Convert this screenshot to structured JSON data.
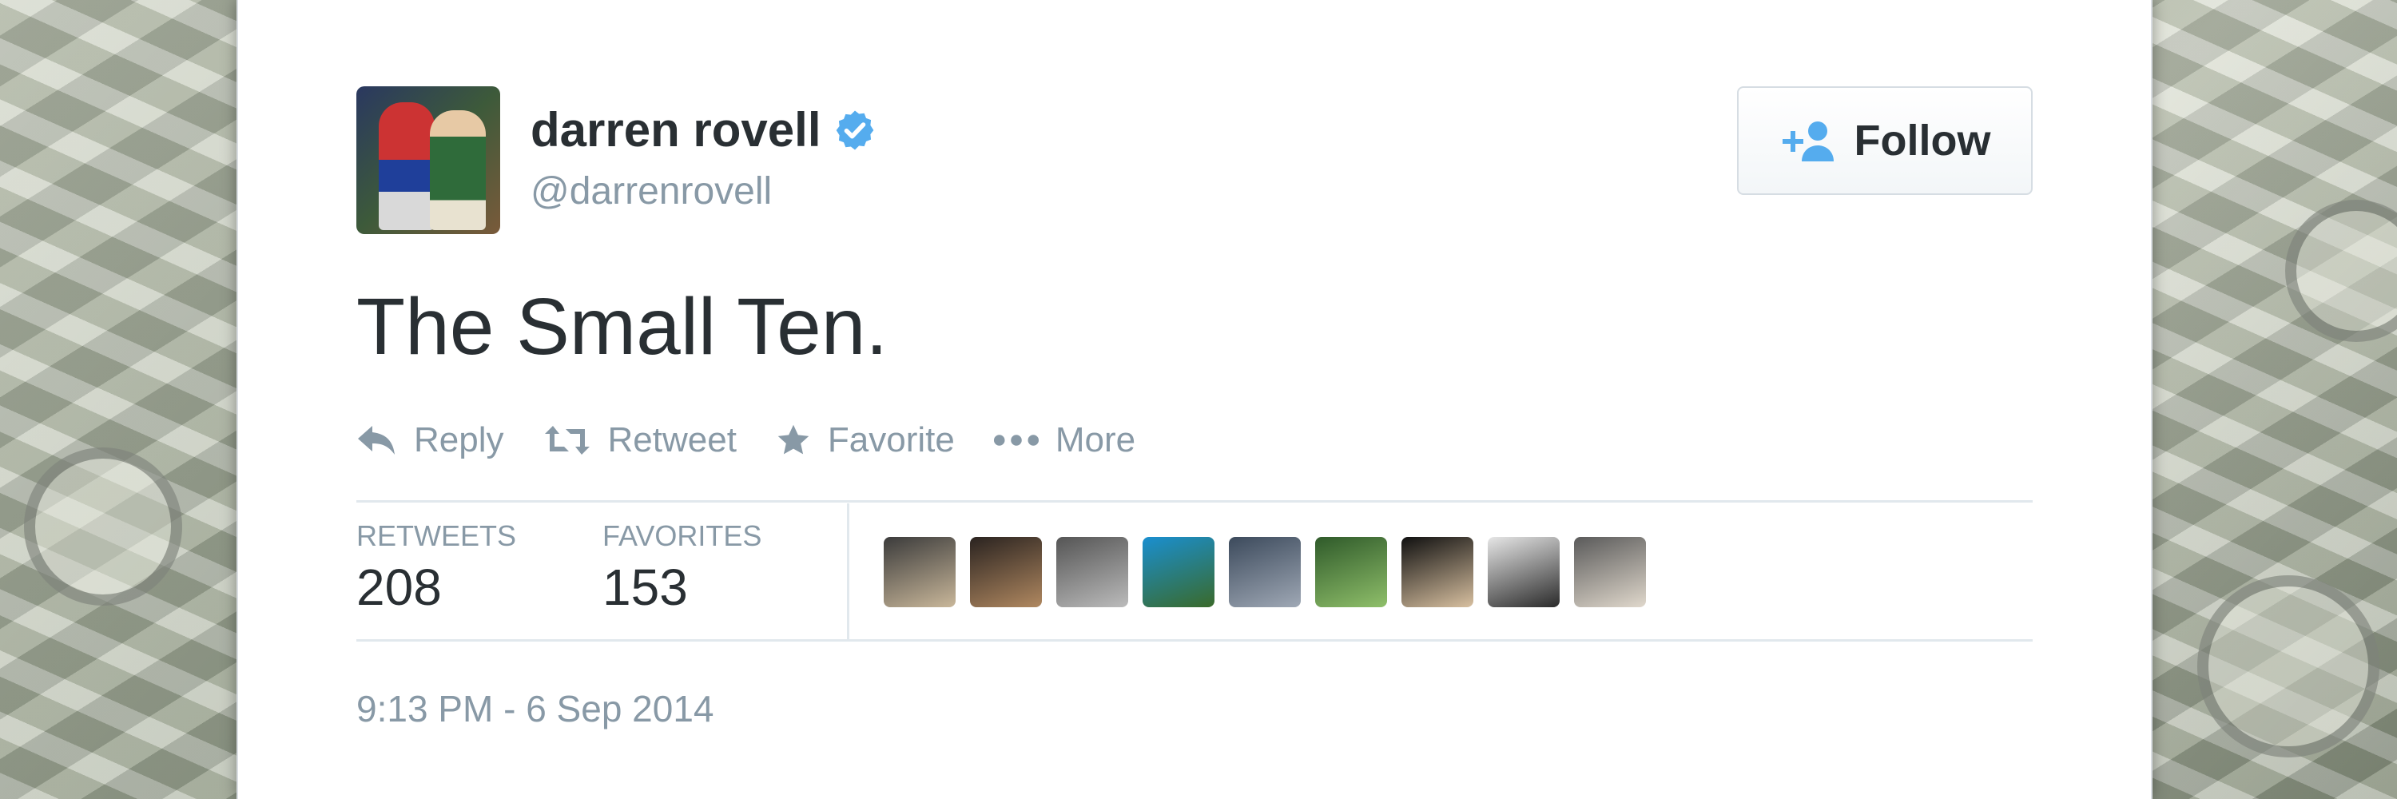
{
  "author": {
    "name": "darren rovell",
    "handle": "@darrenrovell"
  },
  "follow_button": {
    "label": "Follow",
    "icon": "add-person-icon"
  },
  "tweet": {
    "text": "The Small Ten."
  },
  "actions": [
    {
      "label": "Reply",
      "icon": "reply-icon"
    },
    {
      "label": "Retweet",
      "icon": "retweet-icon"
    },
    {
      "label": "Favorite",
      "icon": "star-icon"
    },
    {
      "label": "More",
      "icon": "more-dots-icon"
    }
  ],
  "stats": {
    "retweets_label": "RETWEETS",
    "retweets_count": "208",
    "favorites_label": "FAVORITES",
    "favorites_count": "153"
  },
  "favoriter_avatars": [
    {
      "colors": [
        "#3b3b3b",
        "#c9b79a"
      ]
    },
    {
      "colors": [
        "#2a2320",
        "#b08860"
      ]
    },
    {
      "colors": [
        "#555555",
        "#bbbbbb"
      ]
    },
    {
      "colors": [
        "#1a8fd0",
        "#3a6a2a"
      ]
    },
    {
      "colors": [
        "#3c4a5c",
        "#9fa8b5"
      ]
    },
    {
      "colors": [
        "#2f5a2a",
        "#8fbf6a"
      ]
    },
    {
      "colors": [
        "#101010",
        "#d8c0a0"
      ]
    },
    {
      "colors": [
        "#e6e6e6",
        "#2a2a2a"
      ]
    },
    {
      "colors": [
        "#5a5a5a",
        "#e0d8cc"
      ]
    }
  ],
  "timestamp": "9:13 PM - 6 Sep 2014",
  "colors": {
    "verified_blue": "#55acee",
    "text_dark": "#292f33",
    "text_muted": "#8899a6",
    "border": "#e1e8ed"
  }
}
